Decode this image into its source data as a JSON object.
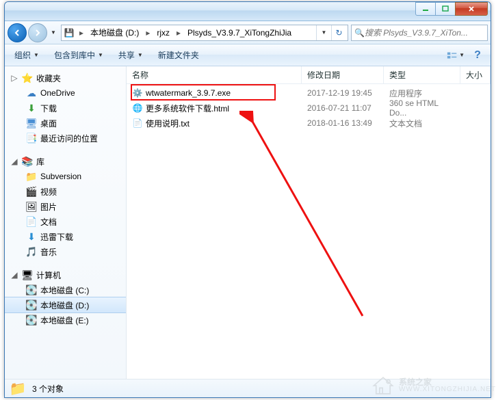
{
  "breadcrumbs": [
    "本地磁盘 (D:)",
    "rjxz",
    "Plsyds_V3.9.7_XiTongZhiJia"
  ],
  "search": {
    "placeholder": "搜索 Plsyds_V3.9.7_XiTon..."
  },
  "toolbar": {
    "organize": "组织",
    "include": "包含到库中",
    "share": "共享",
    "newfolder": "新建文件夹"
  },
  "columns": {
    "name": "名称",
    "date": "修改日期",
    "type": "类型",
    "size": "大小"
  },
  "tree": {
    "favorites": "收藏夹",
    "onedrive": "OneDrive",
    "downloads": "下载",
    "desktop": "桌面",
    "recent": "最近访问的位置",
    "libraries": "库",
    "subversion": "Subversion",
    "videos": "视频",
    "pictures": "图片",
    "documents": "文档",
    "xunlei": "迅雷下载",
    "music": "音乐",
    "computer": "计算机",
    "driveC": "本地磁盘 (C:)",
    "driveD": "本地磁盘 (D:)",
    "driveE": "本地磁盘 (E:)"
  },
  "files": [
    {
      "name": "wtwatermark_3.9.7.exe",
      "date": "2017-12-19 19:45",
      "type": "应用程序",
      "icon": "exe"
    },
    {
      "name": "更多系统软件下载.html",
      "date": "2016-07-21 11:07",
      "type": "360 se HTML Do...",
      "icon": "html"
    },
    {
      "name": "使用说明.txt",
      "date": "2018-01-16 13:49",
      "type": "文本文档",
      "icon": "txt"
    }
  ],
  "status": {
    "count": "3 个对象"
  },
  "watermark": {
    "text": "系统之家",
    "url": "WWW.XITONGZHIJIA.NET"
  }
}
